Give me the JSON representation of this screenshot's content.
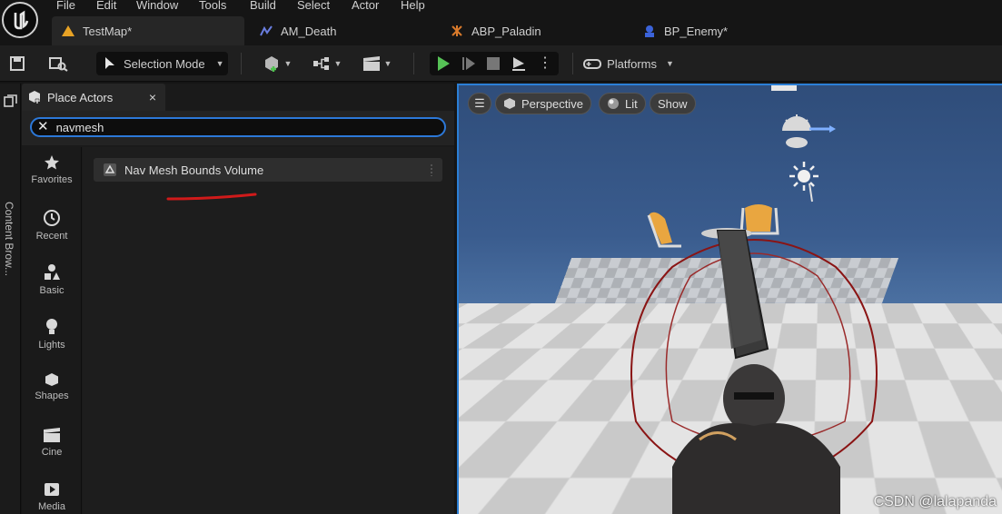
{
  "menu": [
    "File",
    "Edit",
    "Window",
    "Tools",
    "Build",
    "Select",
    "Actor",
    "Help"
  ],
  "tabs": [
    {
      "label": "TestMap*",
      "icon": "level-icon"
    },
    {
      "label": "AM_Death",
      "icon": "anim-montage-icon"
    },
    {
      "label": "ABP_Paladin",
      "icon": "anim-blueprint-icon"
    },
    {
      "label": "BP_Enemy*",
      "icon": "blueprint-icon"
    }
  ],
  "toolbar": {
    "mode_label": "Selection Mode",
    "platforms_label": "Platforms"
  },
  "left_strip": {
    "content_browser_label": "Content Brow..."
  },
  "panel": {
    "tab_title": "Place Actors",
    "close_glyph": "×",
    "search_value": "navmesh",
    "categories": [
      "Favorites",
      "Recent",
      "Basic",
      "Lights",
      "Shapes",
      "Cine",
      "Media"
    ],
    "result_label": "Nav Mesh Bounds Volume"
  },
  "viewport": {
    "perspective_label": "Perspective",
    "lit_label": "Lit",
    "show_label": "Show"
  },
  "watermark": "CSDN @lalapanda",
  "colors": {
    "accent_blue": "#2c78d8",
    "play_green": "#56c256",
    "annotation_red": "#d01a1a"
  }
}
